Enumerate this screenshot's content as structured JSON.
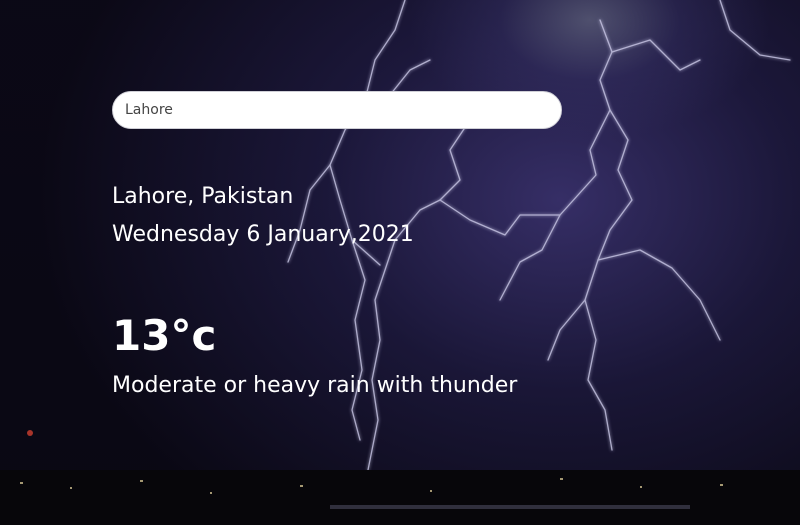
{
  "search": {
    "value": "Lahore",
    "placeholder": ""
  },
  "location": {
    "city_country": "Lahore, Pakistan",
    "date": "Wednesday 6 January,2021"
  },
  "weather": {
    "temperature": "13°c",
    "condition": "Moderate or heavy rain with thunder"
  },
  "background": {
    "icon": "lightning-storm-photo",
    "accent": "#3a326e"
  }
}
